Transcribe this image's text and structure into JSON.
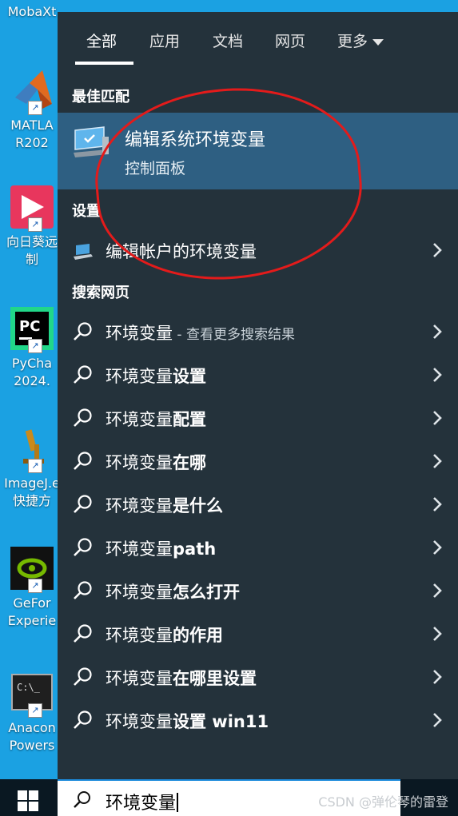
{
  "desktop": {
    "icons": [
      {
        "label": "MobaXt",
        "sub": "",
        "name": "mobaxterm"
      },
      {
        "label": "MATLA",
        "sub": "R202",
        "name": "matlab"
      },
      {
        "label": "向日葵远",
        "sub": "制",
        "name": "sunlogin"
      },
      {
        "label": "PyCha",
        "sub": "2024.",
        "name": "pycharm"
      },
      {
        "label": "ImageJ.e",
        "sub": "快捷方",
        "name": "imagej"
      },
      {
        "label": "GeFor",
        "sub": "Experie",
        "name": "geforce"
      },
      {
        "label": "Anacon",
        "sub": "Powers",
        "name": "anaconda"
      }
    ]
  },
  "search": {
    "tabs": [
      "全部",
      "应用",
      "文档",
      "网页",
      "更多"
    ],
    "best_match_heading": "最佳匹配",
    "best_match": {
      "title": "编辑系统环境变量",
      "subtitle": "控制面板"
    },
    "settings_heading": "设置",
    "settings_item": "编辑帐户的环境变量",
    "web_heading": "搜索网页",
    "web_first": {
      "main": "环境变量",
      "sub": " - 查看更多搜索结果"
    },
    "web_items": [
      {
        "prefix": "环境变量",
        "bold": "设置"
      },
      {
        "prefix": "环境变量",
        "bold": "配置"
      },
      {
        "prefix": "环境变量",
        "bold": "在哪"
      },
      {
        "prefix": "环境变量",
        "bold": "是什么"
      },
      {
        "prefix": "环境变量",
        "bold": "path"
      },
      {
        "prefix": "环境变量",
        "bold": "怎么打开"
      },
      {
        "prefix": "环境变量",
        "bold": "的作用"
      },
      {
        "prefix": "环境变量",
        "bold": "在哪里设置"
      },
      {
        "prefix": "环境变量",
        "bold": "设置 win11"
      }
    ],
    "query": "环境变量"
  },
  "watermark": "CSDN @弹伦琴的雷登",
  "colors": {
    "panel": "#24323b",
    "highlight": "#2e5f82",
    "annotation": "#e31b1b",
    "desktop": "#1ba1e2"
  }
}
